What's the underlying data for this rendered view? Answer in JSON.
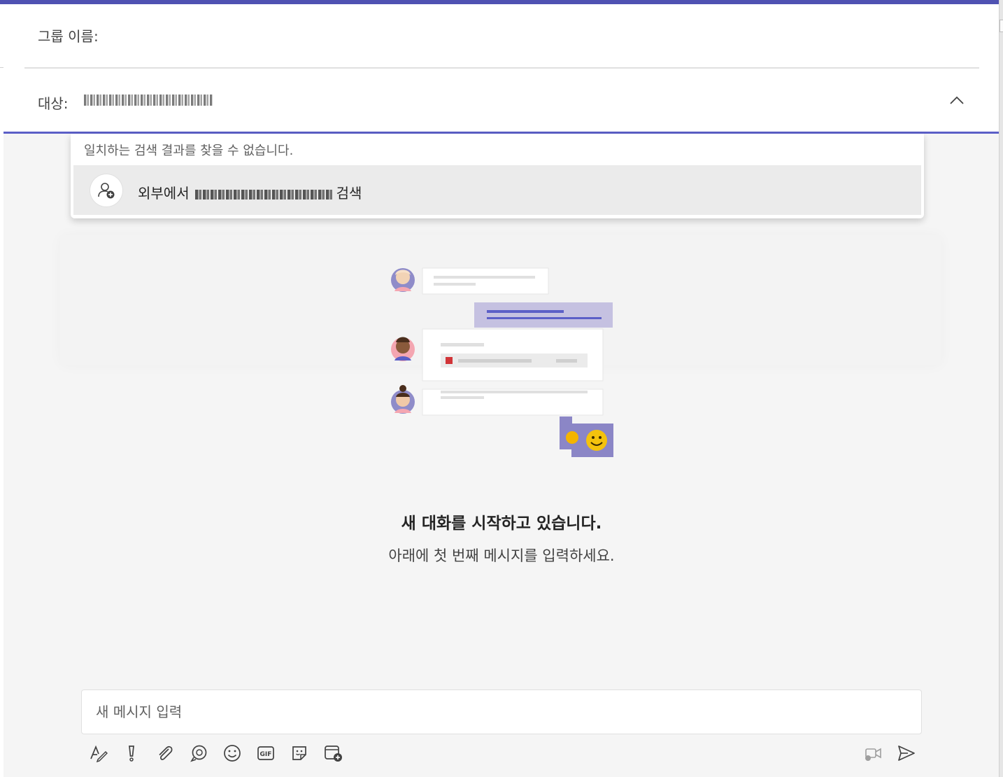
{
  "header": {
    "group_name_label": "그룹 이름:",
    "to_label": "대상:",
    "to_value": "20573@hanmail.net"
  },
  "dropdown": {
    "no_results": "일치하는 검색 결과를 찾을 수 없습니다.",
    "search_prefix": "외부에서",
    "search_suffix": "검색",
    "search_query": "20573@hanmail.net"
  },
  "empty_state": {
    "title": "새 대화를 시작하고 있습니다.",
    "subtitle": "아래에 첫 번째 메시지를 입력하세요."
  },
  "compose": {
    "placeholder": "새 메시지 입력"
  },
  "toolbar": {
    "items": [
      "format-icon",
      "important-icon",
      "attach-icon",
      "loop-icon",
      "emoji-icon",
      "gif-icon",
      "sticker-icon",
      "schedule-meeting-icon"
    ],
    "right_items": [
      "video-clip-icon",
      "send-icon"
    ]
  },
  "colors": {
    "accent": "#5b5fc7",
    "top_strip": "#4f52b2",
    "bubble_purple": "#c5c1e1",
    "emoji_bg": "#8b86c6"
  }
}
